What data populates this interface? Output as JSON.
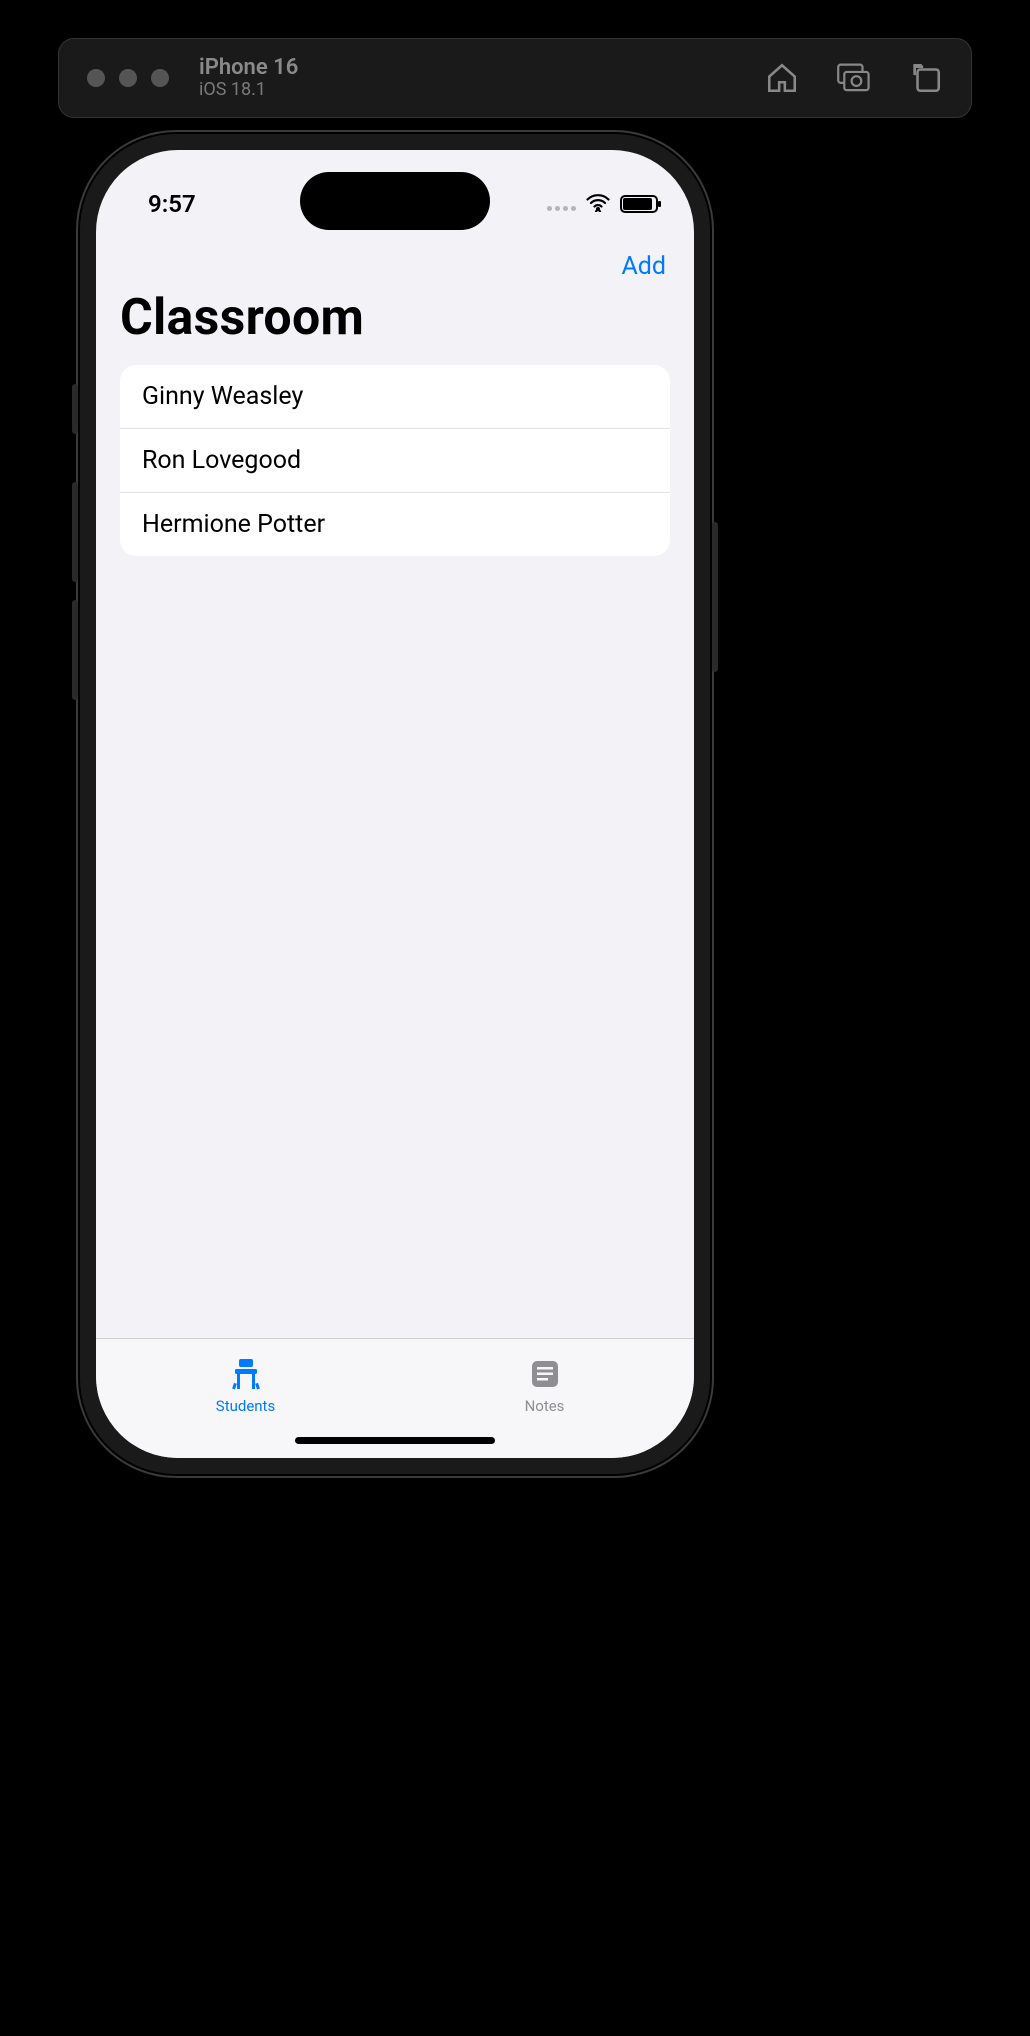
{
  "simulator": {
    "device": "iPhone 16",
    "os": "iOS 18.1"
  },
  "status": {
    "time": "9:57"
  },
  "nav": {
    "add_label": "Add"
  },
  "page": {
    "title": "Classroom"
  },
  "students": [
    {
      "name": "Ginny Weasley"
    },
    {
      "name": "Ron Lovegood"
    },
    {
      "name": "Hermione Potter"
    }
  ],
  "tabs": {
    "students_label": "Students",
    "notes_label": "Notes"
  },
  "colors": {
    "accent": "#007aff",
    "background": "#f2f2f7",
    "secondary": "#8e8e93"
  }
}
